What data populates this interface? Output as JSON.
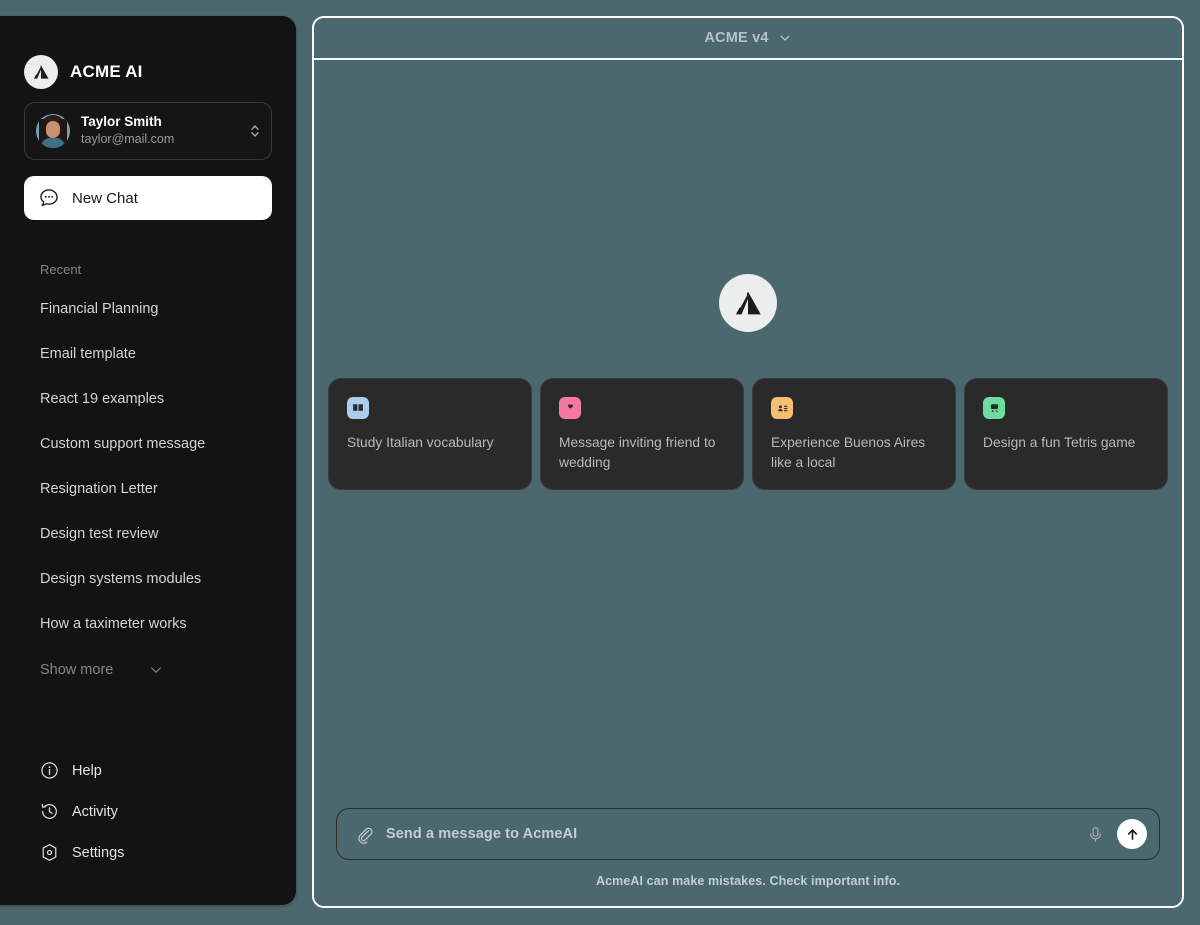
{
  "app": {
    "brand_name": "ACME AI",
    "logo_icon": "acme-logo-icon"
  },
  "sidebar": {
    "profile": {
      "name": "Taylor Smith",
      "email": "taylor@mail.com",
      "avatar_icon": "user-avatar",
      "selector_icon": "chevron-up-down-icon"
    },
    "new_chat": {
      "label": "New Chat",
      "icon": "chat-bubble-dots-icon"
    },
    "recent_label": "Recent",
    "recent_items": [
      {
        "label": "Financial Planning"
      },
      {
        "label": "Email template"
      },
      {
        "label": "React 19 examples"
      },
      {
        "label": "Custom support message"
      },
      {
        "label": "Resignation Letter"
      },
      {
        "label": "Design test review"
      },
      {
        "label": "Design systems modules"
      },
      {
        "label": "How a taximeter works"
      }
    ],
    "show_more": {
      "label": "Show more",
      "icon": "chevron-down-icon"
    },
    "bottom_items": [
      {
        "label": "Help",
        "icon": "info-circle-icon"
      },
      {
        "label": "Activity",
        "icon": "history-clock-icon"
      },
      {
        "label": "Settings",
        "icon": "settings-hexagon-icon"
      }
    ]
  },
  "main": {
    "topbar": {
      "title": "ACME v4",
      "dropdown_icon": "chevron-down-icon"
    },
    "hero_logo_icon": "acme-logo-icon",
    "cards": [
      {
        "text": "Study Italian vocabulary",
        "icon": "book-icon",
        "icon_bg": "#a9ceef",
        "icon_fg": "#2a2a2a"
      },
      {
        "text": "Message inviting friend to wedding",
        "icon": "heart-bubble-icon",
        "icon_bg": "#f4789f",
        "icon_fg": "#2a2a2a"
      },
      {
        "text": "Experience Buenos Aires like a local",
        "icon": "id-card-icon",
        "icon_bg": "#f6bf70",
        "icon_fg": "#2a2a2a"
      },
      {
        "text": "Design a fun Tetris game",
        "icon": "handheld-console-icon",
        "icon_bg": "#6ddd9e",
        "icon_fg": "#2a2a2a"
      }
    ],
    "composer": {
      "placeholder": "Send a message to AcmeAI",
      "attach_icon": "paperclip-icon",
      "mic_icon": "microphone-icon",
      "send_icon": "arrow-up-icon"
    },
    "disclaimer": "AcmeAI can make mistakes. Check important info."
  },
  "colors": {
    "page_bg": "#4b686f",
    "sidebar_bg": "#131313",
    "card_bg": "#2a2a2a",
    "panel_border": "#fdfdfd",
    "accent_white": "#ffffff"
  }
}
